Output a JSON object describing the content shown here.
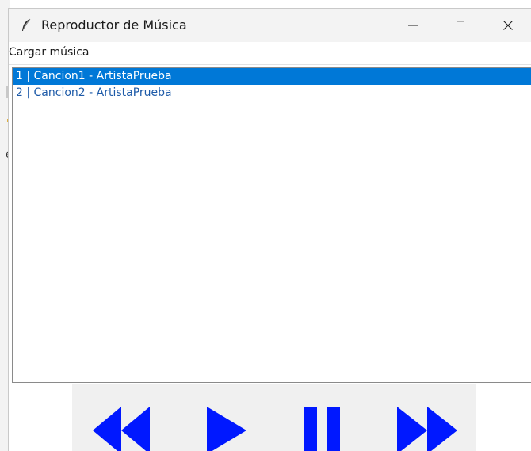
{
  "window": {
    "title": "Reproductor de Música",
    "icon": "feather-icon"
  },
  "window_controls": {
    "minimize": "minimize-icon",
    "maximize": "maximize-icon",
    "close": "close-icon"
  },
  "menu": {
    "items": [
      {
        "label": "Cargar música"
      }
    ]
  },
  "playlist": {
    "selected_index": 0,
    "items": [
      {
        "label": "1 | Cancion1 - ArtistaPrueba"
      },
      {
        "label": "2 | Cancion2 - ArtistaPrueba"
      }
    ]
  },
  "controls": {
    "buttons": [
      "rewind-icon",
      "play-icon",
      "pause-icon",
      "fast-forward-icon"
    ],
    "color": "#0018ff"
  },
  "colors": {
    "selection": "#0078d7",
    "item_text": "#1d5aa8"
  }
}
